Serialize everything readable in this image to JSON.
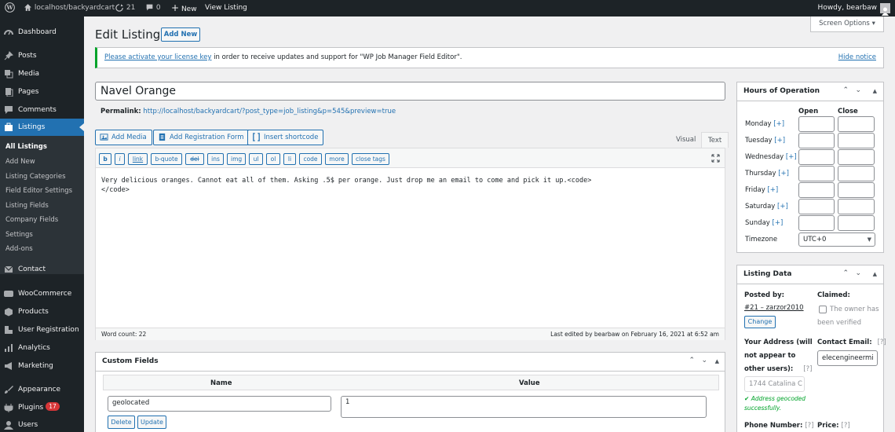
{
  "admin_bar": {
    "site_name": "localhost/backyardcart",
    "updates_count": "21",
    "comments_count": "0",
    "new_label": "New",
    "view_listing": "View Listing",
    "greeting": "Howdy, bearbaw"
  },
  "sidebar": {
    "items": {
      "dashboard": "Dashboard",
      "posts": "Posts",
      "media": "Media",
      "pages": "Pages",
      "comments": "Comments",
      "listings": "Listings",
      "contact": "Contact",
      "woocommerce": "WooCommerce",
      "products": "Products",
      "user_registration": "User Registration",
      "analytics": "Analytics",
      "marketing": "Marketing",
      "appearance": "Appearance",
      "plugins": "Plugins",
      "plugins_badge": "17",
      "users": "Users"
    },
    "submenu": {
      "all_listings": "All Listings",
      "add_new": "Add New",
      "listing_categories": "Listing Categories",
      "field_editor_settings": "Field Editor Settings",
      "listing_fields": "Listing Fields",
      "company_fields": "Company Fields",
      "settings": "Settings",
      "addons": "Add-ons"
    }
  },
  "page": {
    "title": "Edit Listing",
    "add_new": "Add New",
    "screen_options": "Screen Options"
  },
  "notice": {
    "link": "Please activate your license key",
    "text": " in order to receive updates and support for \"WP Job Manager Field Editor\".",
    "dismiss": "Hide notice"
  },
  "post": {
    "title": "Navel Orange",
    "permalink_label": "Permalink:",
    "permalink_url": "http://localhost/backyardcart/?post_type=job_listing&p=545&preview=true"
  },
  "editor": {
    "add_media": "Add Media",
    "add_registration_form": "Add Registration Form",
    "insert_shortcode": "Insert shortcode",
    "tab_visual": "Visual",
    "tab_text": "Text",
    "quicktags": [
      "b",
      "i",
      "link",
      "b-quote",
      "del",
      "ins",
      "img",
      "ul",
      "ol",
      "li",
      "code",
      "more",
      "close tags"
    ],
    "content_line1": "Very delicious oranges. Cannot eat all of them. Asking .5$ per orange. Just drop me an email to come and pick it up.<code>",
    "content_line2": "</code>",
    "word_count": "Word count: 22",
    "last_edited": "Last edited by bearbaw on February 16, 2021 at 6:52 am"
  },
  "custom_fields": {
    "title": "Custom Fields",
    "col_name": "Name",
    "col_value": "Value",
    "row_name": "geolocated",
    "row_value": "1",
    "delete": "Delete",
    "update": "Update"
  },
  "hours": {
    "title": "Hours of Operation",
    "col_open": "Open",
    "col_close": "Close",
    "days": [
      "Monday",
      "Tuesday",
      "Wednesday",
      "Thursday",
      "Friday",
      "Saturday",
      "Sunday"
    ],
    "add_label": "[+]",
    "timezone_label": "Timezone",
    "timezone_value": "UTC+0"
  },
  "listing_data": {
    "title": "Listing Data",
    "posted_by_label": "Posted by:",
    "posted_by_value": "#21 – zarzor2010",
    "change": "Change",
    "claimed_label": "Claimed:",
    "claimed_text": "The owner has been verified",
    "address_label_1": "Your Address (will",
    "address_label_2": "not appear to",
    "address_label_3": "other users):",
    "help": "[?]",
    "address_value": "1744 Catalina C",
    "geocoded_1": "Address geocoded",
    "geocoded_2": "successfully.",
    "email_label": "Contact Email:",
    "email_value": "elecengineermi",
    "phone_label": "Phone Number:",
    "price_label": "Price:"
  }
}
